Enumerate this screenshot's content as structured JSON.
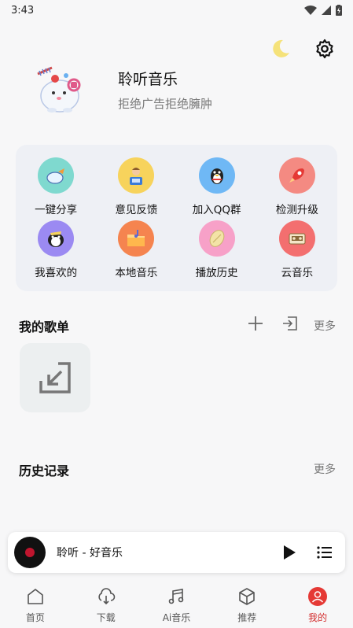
{
  "status_bar": {
    "time": "3:43"
  },
  "profile": {
    "app_name": "聆听音乐",
    "slogan": "拒绝广告拒绝臃肿"
  },
  "quick_actions": [
    {
      "label": "一键分享",
      "icon": "share-icon",
      "color": "#7fd9cf"
    },
    {
      "label": "意见反馈",
      "icon": "feedback-icon",
      "color": "#f7d35c"
    },
    {
      "label": "加入QQ群",
      "icon": "qq-penguin-icon",
      "color": "#6fb8f5"
    },
    {
      "label": "检测升级",
      "icon": "upgrade-rocket-icon",
      "color": "#f48a82"
    },
    {
      "label": "我喜欢的",
      "icon": "favorite-icon",
      "color": "#9b8af2"
    },
    {
      "label": "本地音乐",
      "icon": "local-music-icon",
      "color": "#f5844f"
    },
    {
      "label": "播放历史",
      "icon": "history-icon",
      "color": "#f7a1c8"
    },
    {
      "label": "云音乐",
      "icon": "cloud-music-icon",
      "color": "#f36f6f"
    }
  ],
  "playlists": {
    "title": "我的歌单",
    "more": "更多"
  },
  "history": {
    "title": "历史记录",
    "more": "更多"
  },
  "player": {
    "song": "聆听 - 好音乐"
  },
  "nav": [
    {
      "label": "首页",
      "icon": "home-icon"
    },
    {
      "label": "下载",
      "icon": "download-icon"
    },
    {
      "label": "Ai音乐",
      "icon": "music-note-icon"
    },
    {
      "label": "推荐",
      "icon": "cube-icon"
    },
    {
      "label": "我的",
      "icon": "user-icon",
      "active": true
    }
  ],
  "colors": {
    "accent": "#d32f2f",
    "moon": "#f5e27a"
  }
}
